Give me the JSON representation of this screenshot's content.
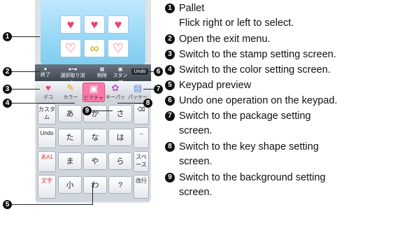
{
  "legend": [
    {
      "num": "1",
      "lines": [
        "Pallet",
        "Flick right or left to select."
      ]
    },
    {
      "num": "2",
      "lines": [
        "Open the exit menu."
      ]
    },
    {
      "num": "3",
      "lines": [
        "Switch to the stamp setting screen."
      ]
    },
    {
      "num": "4",
      "lines": [
        "Switch to the color setting screen."
      ]
    },
    {
      "num": "5",
      "lines": [
        "Keypad preview"
      ]
    },
    {
      "num": "6",
      "lines": [
        "Undo one operation on the keypad."
      ]
    },
    {
      "num": "7",
      "lines": [
        "Switch to the package setting",
        "screen."
      ]
    },
    {
      "num": "8",
      "lines": [
        "Switch to the key shape setting",
        "screen."
      ]
    },
    {
      "num": "9",
      "lines": [
        "Switch to the background setting",
        "screen."
      ]
    }
  ],
  "phone": {
    "menubar": {
      "exit": "終了",
      "undo": "Undo",
      "item2": "選択取り消し",
      "item3": "削除",
      "item4": "スタンプ"
    },
    "tabs": [
      {
        "label": "デコ"
      },
      {
        "label": "カラー"
      },
      {
        "label": "ピクチャ"
      },
      {
        "label": "キーパッド"
      },
      {
        "label": "パッケージ"
      }
    ],
    "keys": {
      "r1": [
        "あ",
        "か",
        "さ"
      ],
      "r2": [
        "た",
        "な",
        "は"
      ],
      "r3": [
        "ま",
        "や",
        "ら"
      ],
      "r4": [
        "小",
        "わ",
        "?"
      ],
      "side_left": [
        "カスタム",
        "Undo",
        "あA1",
        "文字"
      ],
      "side_right": [
        "⌫",
        "→",
        "スペース",
        "改行"
      ]
    }
  }
}
